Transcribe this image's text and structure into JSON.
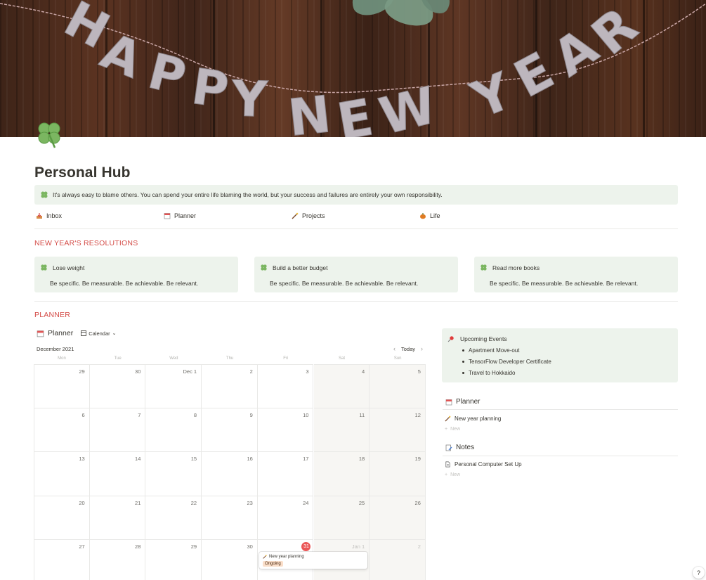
{
  "cover": {
    "text": "HAPPY NEW YEAR"
  },
  "page": {
    "title": "Personal Hub",
    "quote": "It's always easy to blame others. You can spend your entire life blaming the world, but your success and failures are entirely your own responsibility."
  },
  "nav": [
    {
      "label": "Inbox",
      "icon": "inbox-tray-icon"
    },
    {
      "label": "Planner",
      "icon": "calendar-icon"
    },
    {
      "label": "Projects",
      "icon": "magic-wand-icon"
    },
    {
      "label": "Life",
      "icon": "pumpkin-icon"
    }
  ],
  "resolutions": {
    "heading": "NEW YEAR'S RESOLUTIONS",
    "cards": [
      {
        "title": "Lose weight",
        "body": "Be specific. Be measurable. Be achievable. Be relevant."
      },
      {
        "title": "Build a better budget",
        "body": "Be specific. Be measurable. Be achievable. Be relevant."
      },
      {
        "title": "Read more books",
        "body": "Be specific. Be measurable. Be achievable. Be relevant."
      }
    ]
  },
  "planner": {
    "heading": "PLANNER",
    "db_title": "Planner",
    "view": "Calendar",
    "month": "December 2021",
    "today_label": "Today",
    "weekdays": [
      "Mon",
      "Tue",
      "Wed",
      "Thu",
      "Fri",
      "Sat",
      "Sun"
    ],
    "weeks": [
      [
        "29",
        "30",
        "Dec 1",
        "2",
        "3",
        "4",
        "5"
      ],
      [
        "6",
        "7",
        "8",
        "9",
        "10",
        "11",
        "12"
      ],
      [
        "13",
        "14",
        "15",
        "16",
        "17",
        "18",
        "19"
      ],
      [
        "20",
        "21",
        "22",
        "23",
        "24",
        "25",
        "26"
      ],
      [
        "27",
        "28",
        "29",
        "30",
        "31",
        "Jan 1",
        "2"
      ]
    ],
    "today": "31",
    "event": {
      "title": "New year planning",
      "status": "Ongoing",
      "status_color": "#fadec9"
    }
  },
  "sidebar": {
    "upcoming": {
      "title": "Upcoming Events",
      "items": [
        "Apartment Move-out",
        "TensorFlow Developer Certificate",
        "Travel to Hokkaido"
      ]
    },
    "planner_db": {
      "title": "Planner",
      "rows": [
        "New year planning"
      ],
      "new_label": "New"
    },
    "notes_db": {
      "title": "Notes",
      "rows": [
        "Personal Computer Set Up"
      ],
      "new_label": "New"
    }
  },
  "help": {
    "label": "?"
  },
  "colors": {
    "accent_red": "#d44c47",
    "callout_green": "#edf3ec",
    "today_red": "#eb5757",
    "text": "#37352f"
  }
}
